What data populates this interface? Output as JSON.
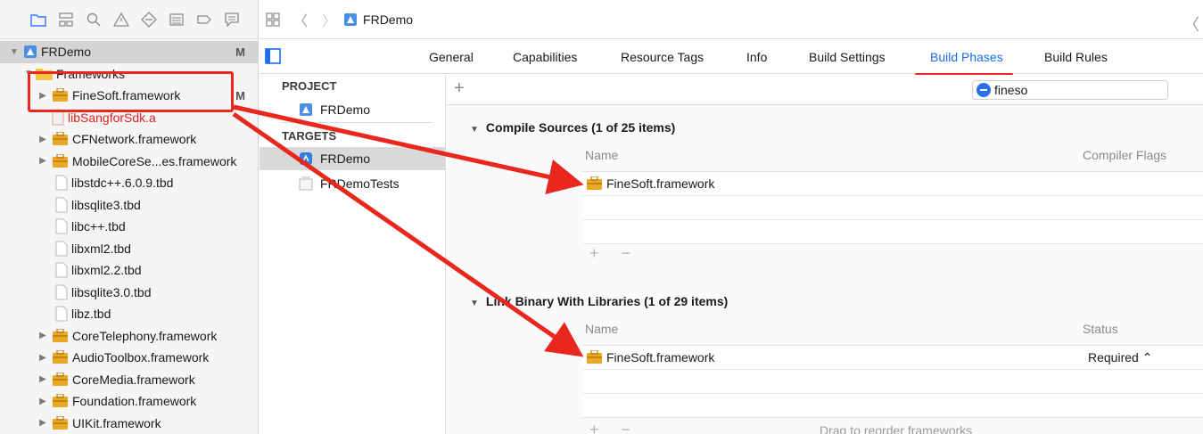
{
  "navigator": {
    "toolbar_icons": [
      "folder-icon",
      "hierarchy-icon",
      "find-icon",
      "warning-icon",
      "test-icon",
      "debug-icon",
      "breakpoint-icon",
      "report-icon"
    ],
    "items": [
      {
        "label": "FRDemo",
        "badge": "M",
        "kind": "project",
        "indent": 0,
        "disclosure": "▼",
        "selected": true
      },
      {
        "label": "Frameworks",
        "badge": "",
        "kind": "folder",
        "indent": 1,
        "disclosure": "▼"
      },
      {
        "label": "FineSoft.framework",
        "badge": "M",
        "kind": "framework",
        "indent": 2,
        "disclosure": "▶"
      },
      {
        "label": "libSangforSdk.a",
        "badge": "",
        "kind": "lib-red",
        "indent": 2,
        "disclosure": ""
      },
      {
        "label": "CFNetwork.framework",
        "badge": "",
        "kind": "framework",
        "indent": 2,
        "disclosure": "▶"
      },
      {
        "label": "MobileCoreSe...es.framework",
        "badge": "",
        "kind": "framework",
        "indent": 2,
        "disclosure": "▶"
      },
      {
        "label": "libstdc++.6.0.9.tbd",
        "badge": "",
        "kind": "file",
        "indent": 2,
        "disclosure": ""
      },
      {
        "label": "libsqlite3.tbd",
        "badge": "",
        "kind": "file",
        "indent": 2,
        "disclosure": ""
      },
      {
        "label": "libc++.tbd",
        "badge": "",
        "kind": "file",
        "indent": 2,
        "disclosure": ""
      },
      {
        "label": "libxml2.tbd",
        "badge": "",
        "kind": "file",
        "indent": 2,
        "disclosure": ""
      },
      {
        "label": "libxml2.2.tbd",
        "badge": "",
        "kind": "file",
        "indent": 2,
        "disclosure": ""
      },
      {
        "label": "libsqlite3.0.tbd",
        "badge": "",
        "kind": "file",
        "indent": 2,
        "disclosure": ""
      },
      {
        "label": "libz.tbd",
        "badge": "",
        "kind": "file",
        "indent": 2,
        "disclosure": ""
      },
      {
        "label": "CoreTelephony.framework",
        "badge": "",
        "kind": "framework",
        "indent": 2,
        "disclosure": "▶"
      },
      {
        "label": "AudioToolbox.framework",
        "badge": "",
        "kind": "framework",
        "indent": 2,
        "disclosure": "▶"
      },
      {
        "label": "CoreMedia.framework",
        "badge": "",
        "kind": "framework",
        "indent": 2,
        "disclosure": "▶"
      },
      {
        "label": "Foundation.framework",
        "badge": "",
        "kind": "framework",
        "indent": 2,
        "disclosure": "▶"
      },
      {
        "label": "UIKit.framework",
        "badge": "",
        "kind": "framework",
        "indent": 2,
        "disclosure": "▶"
      }
    ]
  },
  "jumpbar": {
    "crumb": "FRDemo"
  },
  "tabs": [
    "General",
    "Capabilities",
    "Resource Tags",
    "Info",
    "Build Settings",
    "Build Phases",
    "Build Rules"
  ],
  "active_tab": "Build Phases",
  "targets_panel": {
    "project_header": "PROJECT",
    "project_item": "FRDemo",
    "targets_header": "TARGETS",
    "target_items": [
      "FRDemo",
      "FRDemoTests"
    ]
  },
  "filter": {
    "value": "fineso"
  },
  "compile_sources": {
    "title": "Compile Sources (1 of 25 items)",
    "col_name": "Name",
    "col_flags": "Compiler Flags",
    "rows": [
      "FineSoft.framework"
    ]
  },
  "link_binary": {
    "title": "Link Binary With Libraries (1 of 29 items)",
    "col_name": "Name",
    "col_status": "Status",
    "rows": [
      {
        "name": "FineSoft.framework",
        "status": "Required ⌃"
      }
    ],
    "hint": "Drag to reorder frameworks"
  },
  "colors": {
    "accent": "#1a6df5",
    "annotation": "#e8281e",
    "missing_file": "#e02020"
  }
}
